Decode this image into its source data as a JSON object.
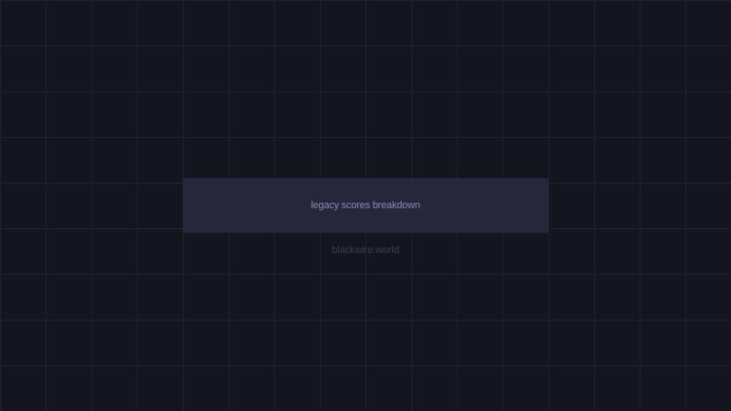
{
  "banner": {
    "label": "legacy scores breakdown"
  },
  "footer": {
    "site": "blackwire.world"
  },
  "colors": {
    "background": "#15151f",
    "grid_line": "#22222e",
    "banner_bg": "#27273c",
    "banner_text": "#8a86b8",
    "footer_text": "#3f3e52"
  }
}
